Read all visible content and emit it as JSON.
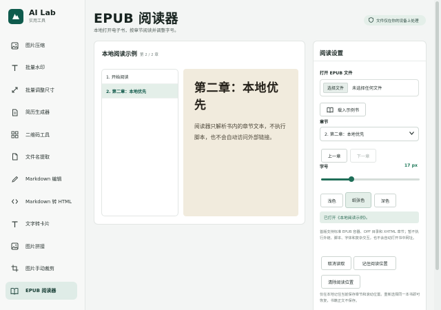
{
  "brand": {
    "name": "AI Lab",
    "subtitle": "实用工具"
  },
  "sidebar": {
    "items": [
      {
        "label": "图片压缩",
        "icon": "image-icon"
      },
      {
        "label": "批量水印",
        "icon": "text-icon"
      },
      {
        "label": "批量调整尺寸",
        "icon": "resize-arrows-icon"
      },
      {
        "label": "简历生成器",
        "icon": "document-icon"
      },
      {
        "label": "二维码工具",
        "icon": "grid-icon"
      },
      {
        "label": "文件名提取",
        "icon": "file-icon"
      },
      {
        "label": "Markdown 编辑",
        "icon": "pen-icon"
      },
      {
        "label": "Markdown 转 HTML",
        "icon": "code-icon"
      },
      {
        "label": "文字转卡片",
        "icon": "text-icon"
      },
      {
        "label": "图片拼接",
        "icon": "image-icon"
      },
      {
        "label": "图片手动裁剪",
        "icon": "crop-icon"
      },
      {
        "label": "EPUB 阅读器",
        "icon": "book-icon",
        "active": true
      }
    ]
  },
  "header": {
    "title": "EPUB 阅读器",
    "subtitle": "本地打开电子书，按章节阅读并调整字号。",
    "privacy_badge": "文件仅在你的设备上处理"
  },
  "reader": {
    "title": "本地阅读示例",
    "chapter_count": "第 2 / 2 章",
    "toc": [
      {
        "label": "1. 开始阅读",
        "active": false
      },
      {
        "label": "2. 第二章：本地优先",
        "active": true
      }
    ],
    "chapter_title": "第二章：本地优先",
    "chapter_body": "阅读器只解析书内的章节文本，不执行脚本，也不会自动访问外部链接。",
    "page_color": "#f1ebdd"
  },
  "settings": {
    "title": "阅读设置",
    "open_label": "打开 EPUB 文件",
    "file_button": "选择文件",
    "file_status": "未选择任何文件",
    "sample_button": "载入示例书",
    "chapter_label": "章节",
    "chapter_selected": "2. 第二章：本地优先",
    "prev_button": "上一章",
    "next_button": "下一章",
    "font_label": "字号",
    "font_value": "17 px",
    "font_slider_fraction": 0.31,
    "themes": [
      {
        "label": "浅色",
        "selected": false
      },
      {
        "label": "纸张色",
        "selected": true
      },
      {
        "label": "深色",
        "selected": false
      }
    ],
    "notice": "已打开《本地阅读示例》。",
    "hint_support": "首版支持标准 EPUB 容器、OPF 目录和 XHTML 章节；暂不执行外链、脚本、字体和复杂交互，也不会自动打开书中网址。",
    "cancel_button": "取消读取",
    "remember_button": "记住阅读位置",
    "clear_button": "清除阅读位置",
    "hint_position": "仅在本地记住当前保存章节和滚动位置。重新选择同一本书即可恢复，书籍正文不保存。"
  },
  "colors": {
    "accent": "#0f5b4d",
    "active_bg": "#dfece7",
    "slider": "#1f6e58"
  }
}
